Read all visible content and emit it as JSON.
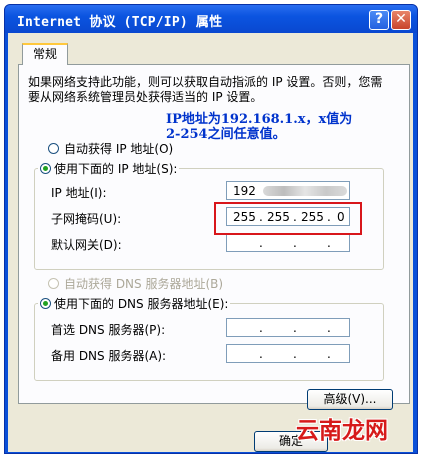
{
  "window": {
    "title": "Internet 协议 (TCP/IP) 属性",
    "help_glyph": "?",
    "close_glyph": "✕"
  },
  "tab": {
    "label": "常规"
  },
  "description": "如果网络支持此功能，则可以获取自动指派的 IP 设置。否则，您需要从网络系统管理员处获得适当的 IP 设置。",
  "annotation": "IP地址为192.168.1.x，x值为2-254之间任意值。",
  "ip_section": {
    "auto_label": "自动获得 IP 地址(O)",
    "manual_label": "使用下面的 IP 地址(S):",
    "selected": "manual",
    "fields": [
      {
        "label": "IP 地址(I):",
        "octets": [
          "192",
          "",
          "",
          ""
        ],
        "obscured": true
      },
      {
        "label": "子网掩码(U):",
        "octets": [
          "255",
          "255",
          "255",
          "0"
        ]
      },
      {
        "label": "默认网关(D):",
        "octets": [
          "",
          "",
          "",
          ""
        ]
      }
    ]
  },
  "dns_section": {
    "auto_label": "自动获得 DNS 服务器地址(B)",
    "auto_disabled": true,
    "manual_label": "使用下面的 DNS 服务器地址(E):",
    "selected": "manual",
    "fields": [
      {
        "label": "首选 DNS 服务器(P):",
        "octets": [
          "",
          "",
          "",
          ""
        ]
      },
      {
        "label": "备用 DNS 服务器(A):",
        "octets": [
          "",
          "",
          "",
          ""
        ]
      }
    ]
  },
  "buttons": {
    "advanced": "高级(V)...",
    "ok": "确定"
  },
  "watermark": "云南龙网",
  "colors": {
    "titlebar": "#0a50d8",
    "annotation": "#0033cc",
    "highlight_box": "#d8161b",
    "radio_dot": "#21a121"
  }
}
